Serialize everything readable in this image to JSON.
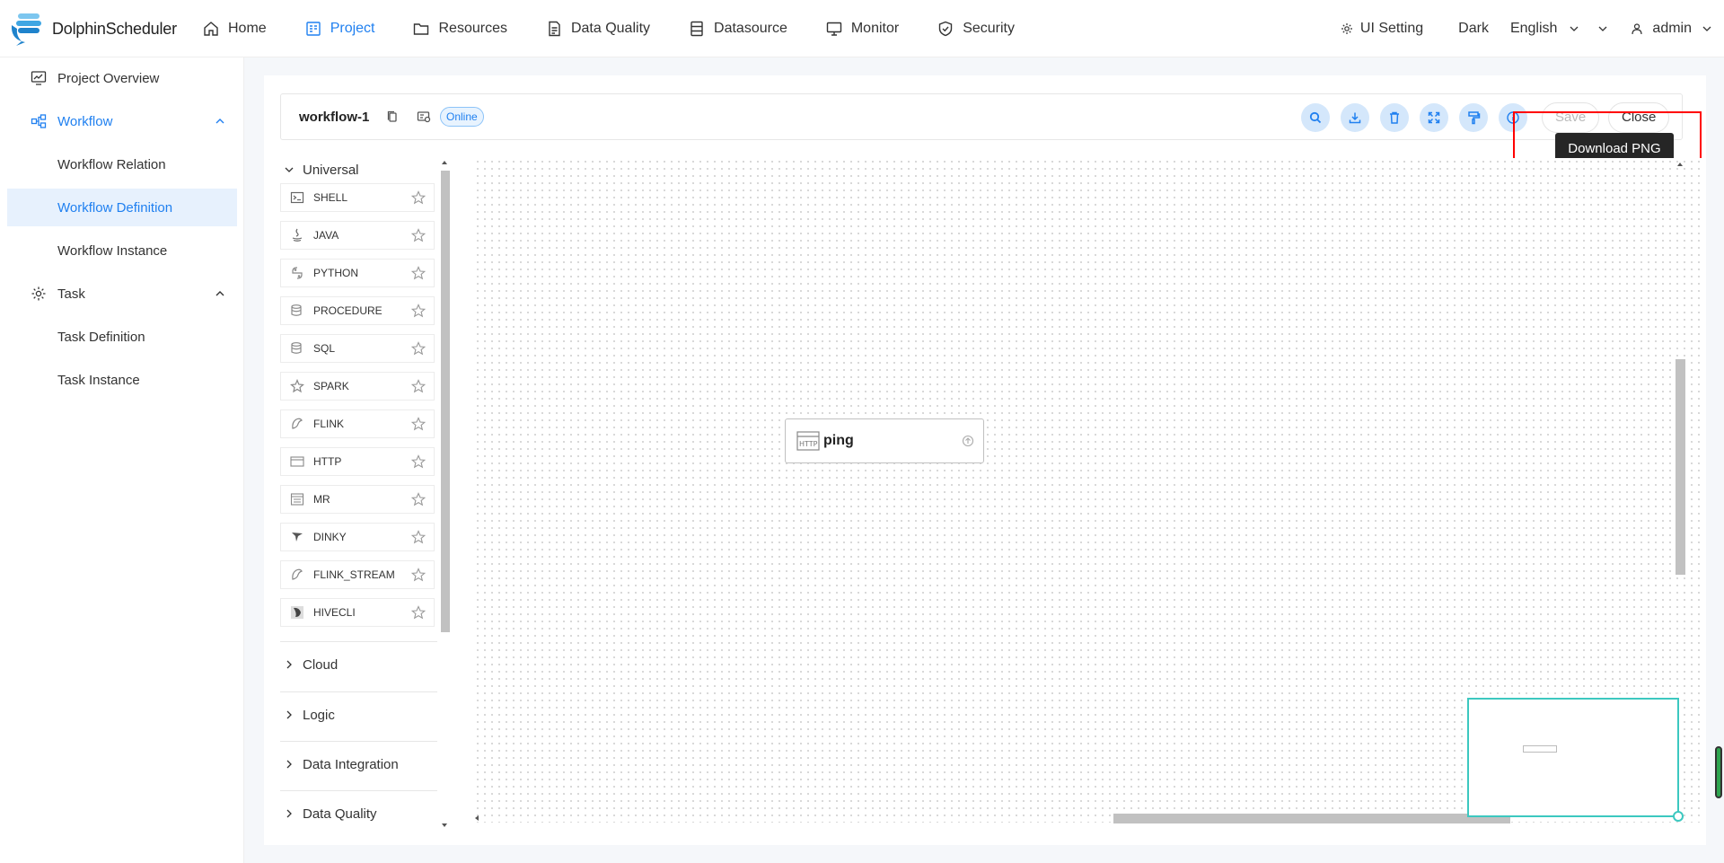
{
  "app": {
    "brand": "DolphinScheduler"
  },
  "nav": {
    "items": [
      {
        "label": "Home",
        "icon": "home-icon"
      },
      {
        "label": "Project",
        "icon": "project-icon",
        "active": true
      },
      {
        "label": "Resources",
        "icon": "folder-icon"
      },
      {
        "label": "Data Quality",
        "icon": "document-icon"
      },
      {
        "label": "Datasource",
        "icon": "database-icon"
      },
      {
        "label": "Monitor",
        "icon": "monitor-icon"
      },
      {
        "label": "Security",
        "icon": "shield-icon"
      }
    ],
    "ui_setting": "UI Setting",
    "theme": "Dark",
    "language": "English",
    "user": "admin"
  },
  "sidebar": {
    "project_overview": "Project Overview",
    "workflow": "Workflow",
    "workflow_relation": "Workflow Relation",
    "workflow_definition": "Workflow Definition",
    "workflow_instance": "Workflow Instance",
    "task": "Task",
    "task_definition": "Task Definition",
    "task_instance": "Task Instance"
  },
  "toolbar": {
    "workflow_name": "workflow-1",
    "status": "Online",
    "tooltip": "Download PNG",
    "save": "Save",
    "close": "Close",
    "icons": [
      "search-icon",
      "download-icon",
      "delete-icon",
      "fullscreen-icon",
      "format-brush-icon",
      "info-icon"
    ]
  },
  "palette": {
    "universal": "Universal",
    "tasks": [
      "SHELL",
      "JAVA",
      "PYTHON",
      "PROCEDURE",
      "SQL",
      "SPARK",
      "FLINK",
      "HTTP",
      "MR",
      "DINKY",
      "FLINK_STREAM",
      "HIVECLI"
    ],
    "cloud": "Cloud",
    "logic": "Logic",
    "data_integration": "Data Integration",
    "data_quality": "Data Quality"
  },
  "canvas": {
    "node": {
      "name": "ping",
      "type_icon": "HTTP"
    }
  },
  "colors": {
    "accent": "#2080f0",
    "highlight": "#ff0000",
    "minimap": "#3cc8c0"
  }
}
